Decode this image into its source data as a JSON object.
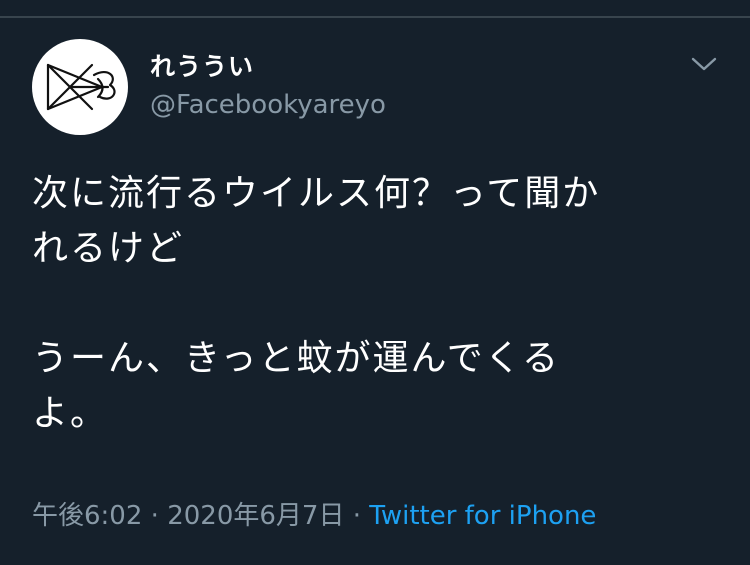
{
  "user": {
    "display_name": "れううい",
    "handle": "@Facebookyareyo"
  },
  "tweet": {
    "text": "次に流行るウイルス何？って聞か\nれるけど\n\nうーん、きっと蚊が運んでくる\nよ。",
    "time": "午後6:02",
    "separator": "·",
    "date": "2020年6月7日",
    "source": "Twitter for iPhone"
  },
  "icons": {
    "menu": "chevron-down-icon",
    "avatar": "avatar-logo-icon"
  },
  "colors": {
    "background": "#15202b",
    "secondary_text": "#8899a6",
    "link": "#1da1f2",
    "divider": "#38444d"
  }
}
